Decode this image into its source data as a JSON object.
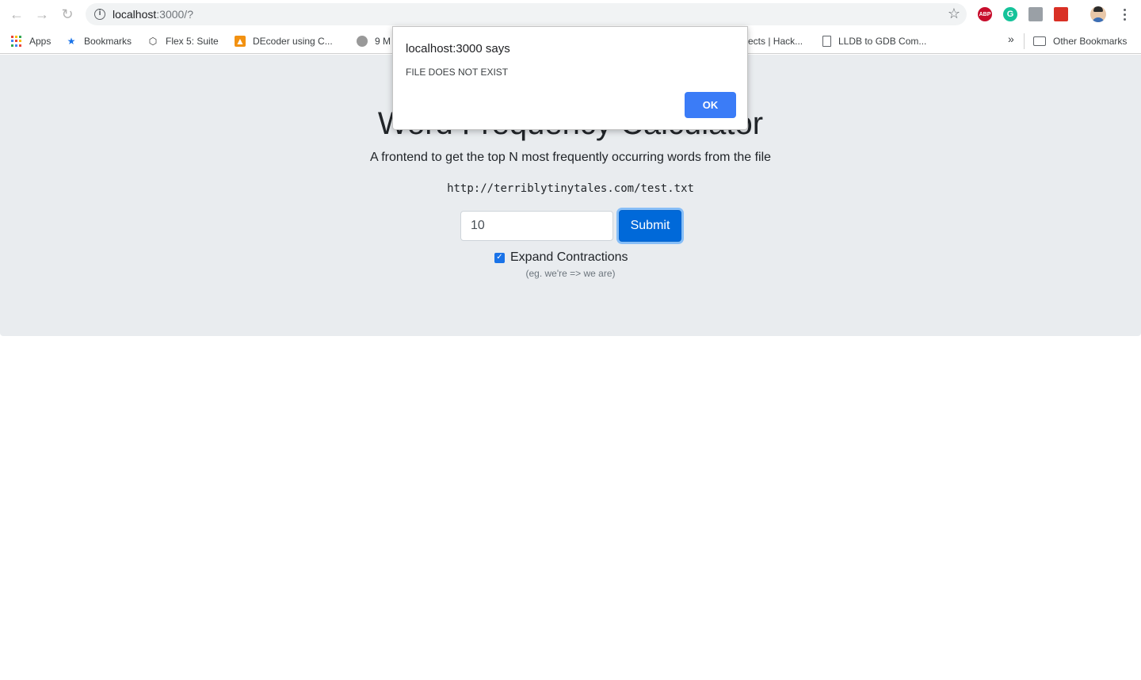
{
  "browser": {
    "url_host": "localhost",
    "url_path": ":3000/?",
    "extensions": [
      "ABP",
      "G",
      "",
      ""
    ],
    "bookmarks": [
      {
        "label": "Apps",
        "icon": "apps-grid-icon"
      },
      {
        "label": "Bookmarks",
        "icon": "star-icon"
      },
      {
        "label": "Flex 5: Suite",
        "icon": "codepen-icon"
      },
      {
        "label": "DEcoder using C...",
        "icon": "decoder-icon"
      },
      {
        "label": "9 M",
        "icon": "site-icon"
      },
      {
        "label": "ects | Hack...",
        "icon": ""
      },
      {
        "label": "LLDB to GDB Com...",
        "icon": "document-icon"
      }
    ],
    "chevron": "»",
    "other_bookmarks": "Other Bookmarks"
  },
  "page": {
    "title": "Word Frequency Calculator",
    "lead": "A frontend to get the top N most frequently occurring words from the file",
    "file_url": "http://terriblytinytales.com/test.txt",
    "count_value": "10",
    "submit_label": "Submit",
    "checkbox_label": "Expand Contractions",
    "checkbox_checked": true,
    "help_text": "(eg. we're => we are)"
  },
  "dialog": {
    "title": "localhost:3000 says",
    "message": "FILE DOES NOT EXIST",
    "ok_label": "OK"
  },
  "colors": {
    "jumbotron": "#e9ecef",
    "submit": "#0069d9",
    "dialog_ok": "#3b7cf7"
  }
}
